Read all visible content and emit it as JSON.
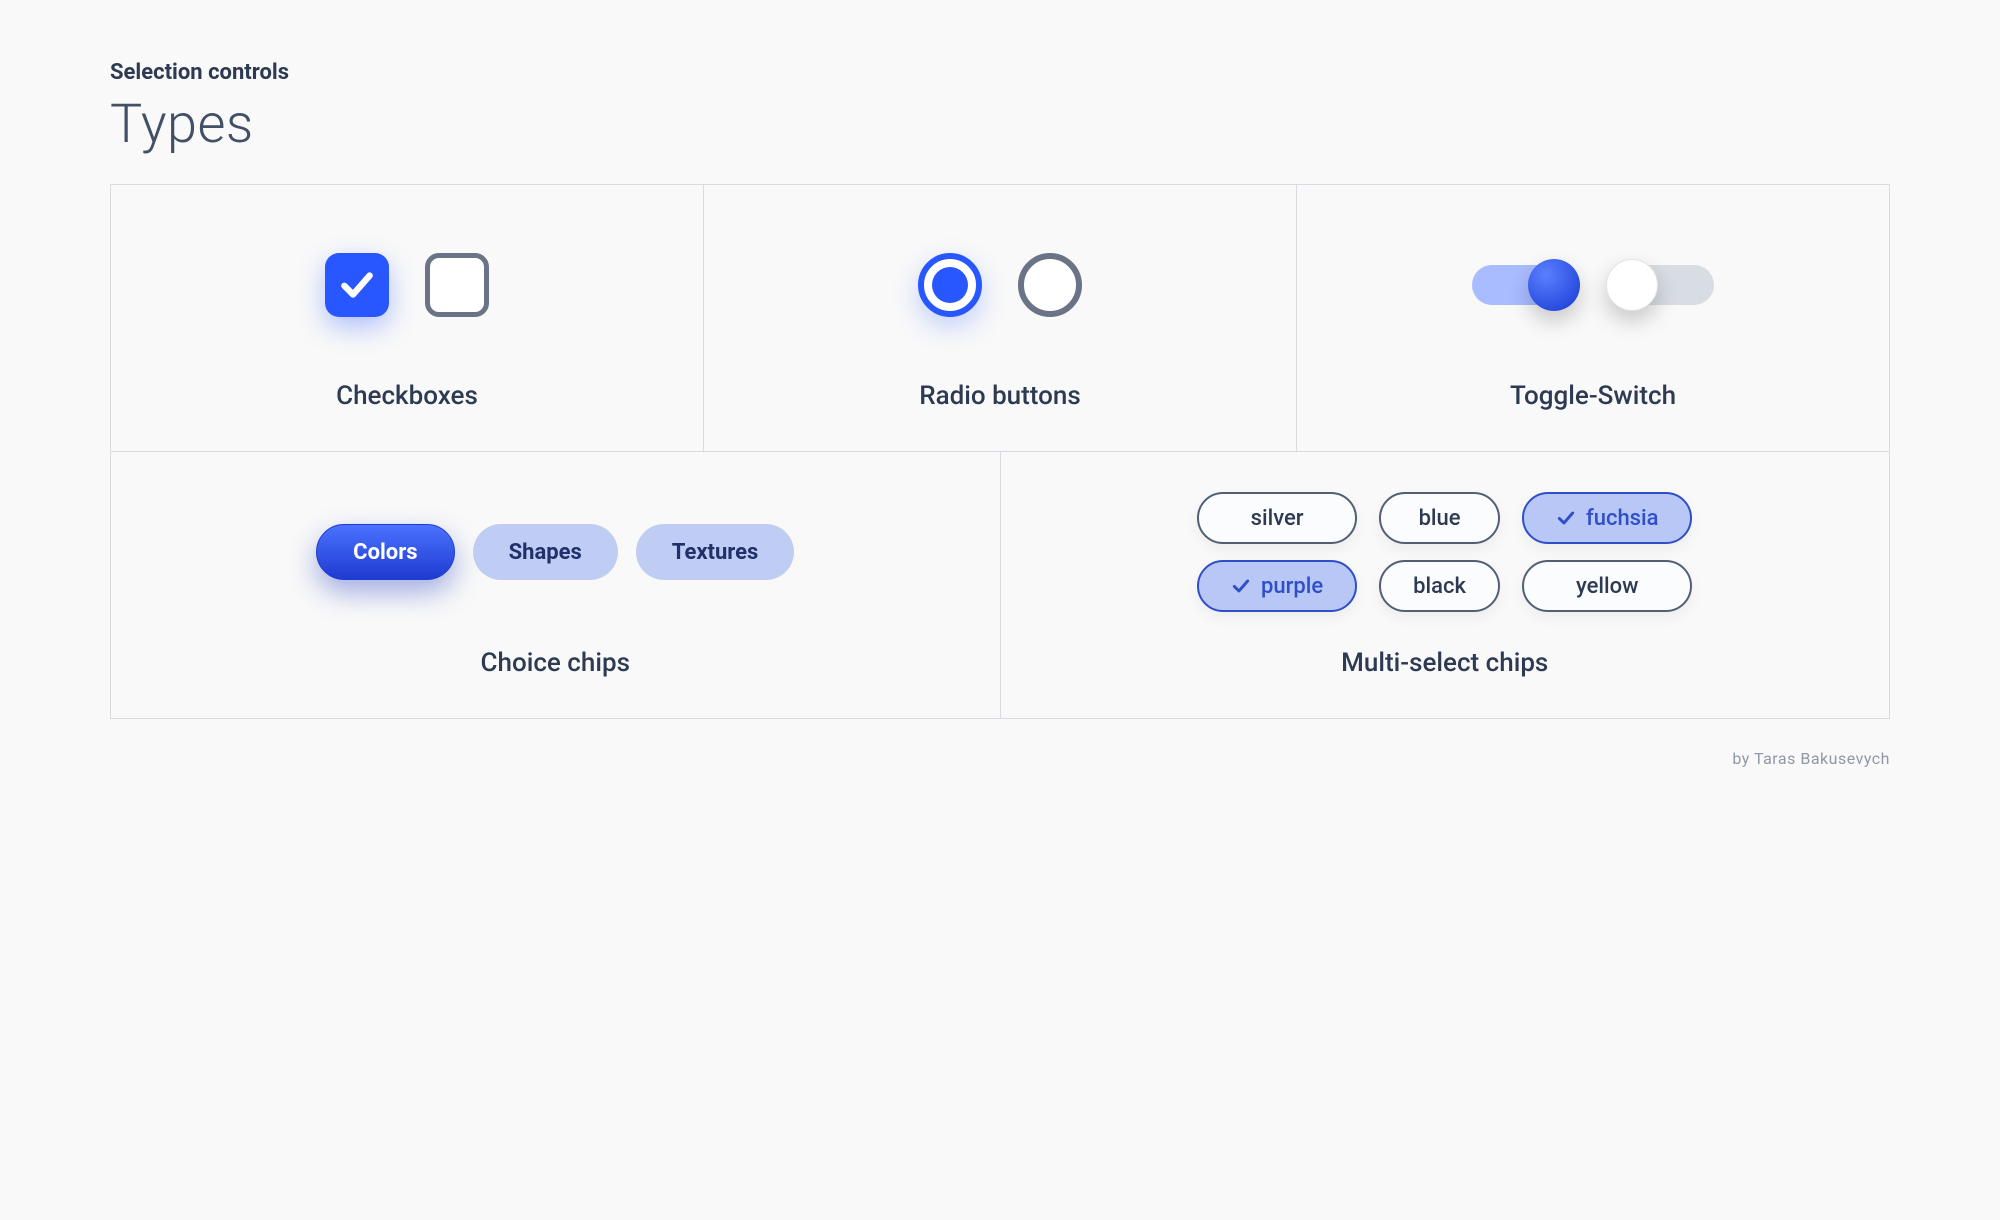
{
  "header": {
    "eyebrow": "Selection controls",
    "title": "Types"
  },
  "panels": {
    "checkboxes": {
      "label": "Checkboxes"
    },
    "radio": {
      "label": "Radio buttons"
    },
    "toggle": {
      "label": "Toggle-Switch"
    },
    "choice": {
      "label": "Choice chips"
    },
    "multi": {
      "label": "Multi-select chips"
    }
  },
  "choice_chips": [
    {
      "label": "Colors",
      "active": true
    },
    {
      "label": "Shapes",
      "active": false
    },
    {
      "label": "Textures",
      "active": false
    }
  ],
  "multi_chips": [
    {
      "label": "silver",
      "selected": false
    },
    {
      "label": "blue",
      "selected": false
    },
    {
      "label": "fuchsia",
      "selected": true
    },
    {
      "label": "purple",
      "selected": true
    },
    {
      "label": "black",
      "selected": false
    },
    {
      "label": "yellow",
      "selected": false
    }
  ],
  "credit": "by Taras Bakusevych",
  "colors": {
    "accent": "#2857ff",
    "track_on": "#a9bcff",
    "track_off": "#d8dde3",
    "chip_bg": "#bfcdf5",
    "border_gray": "#6a7486"
  }
}
